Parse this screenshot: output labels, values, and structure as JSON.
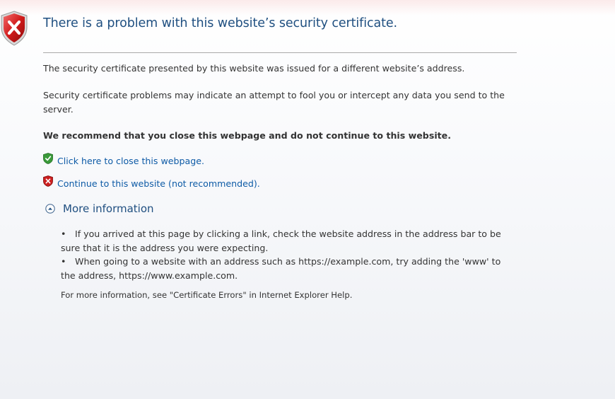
{
  "header": {
    "title": "There is a problem with this website’s security certificate.",
    "icon": "shield-error-icon"
  },
  "body": {
    "paragraph_1": "The security certificate presented by this website was issued for a different website’s address.",
    "paragraph_2": "Security certificate problems may indicate an attempt to fool you or intercept any data you send to the server.",
    "recommendation": "We recommend that you close this webpage and do not continue to this website."
  },
  "actions": {
    "close": {
      "label": "Click here to close this webpage.",
      "icon": "shield-check-icon"
    },
    "continue": {
      "label": "Continue to this website (not recommended).",
      "icon": "shield-x-icon"
    }
  },
  "more_info": {
    "label": "More information",
    "icon": "collapse-arrow-icon",
    "bullets": [
      "If you arrived at this page by clicking a link, check the website address in the address bar to be sure that it is the address you were expecting.",
      "When going to a website with an address such as https://example.com, try adding the 'www' to the address, https://www.example.com."
    ],
    "bullet_char": "•",
    "footnote": "For more information, see \"Certificate Errors\" in Internet Explorer Help."
  },
  "colors": {
    "title": "#1f4f80",
    "link": "#0e5ba6",
    "error_red": "#c8161d",
    "ok_green": "#2f8a2f"
  }
}
